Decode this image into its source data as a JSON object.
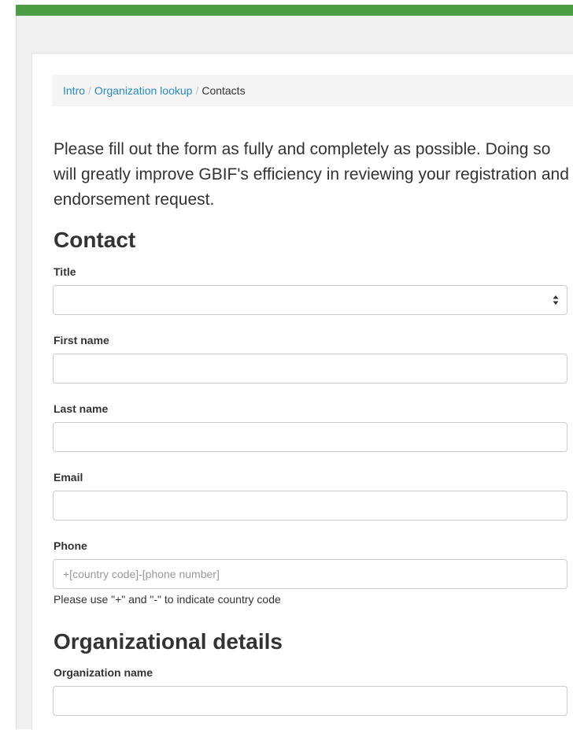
{
  "breadcrumb": {
    "items": [
      "Intro",
      "Organization lookup"
    ],
    "current": "Contacts",
    "separator": "/"
  },
  "intro_text": "Please fill out the form as fully and completely as possible. Doing so will greatly improve GBIF's efficiency in reviewing your registration and endorsement request.",
  "contact_section": {
    "heading": "Contact",
    "title_label": "Title",
    "title_value": "",
    "first_name_label": "First name",
    "last_name_label": "Last name",
    "email_label": "Email",
    "phone_label": "Phone",
    "phone_placeholder": "+[country code]-[phone number]",
    "phone_help": "Please use \"+\" and \"-\" to indicate country code"
  },
  "org_section": {
    "heading": "Organizational details",
    "org_name_label": "Organization name"
  },
  "colors": {
    "accent_green": "#4c9d44",
    "link_blue": "#2a8bc4"
  }
}
